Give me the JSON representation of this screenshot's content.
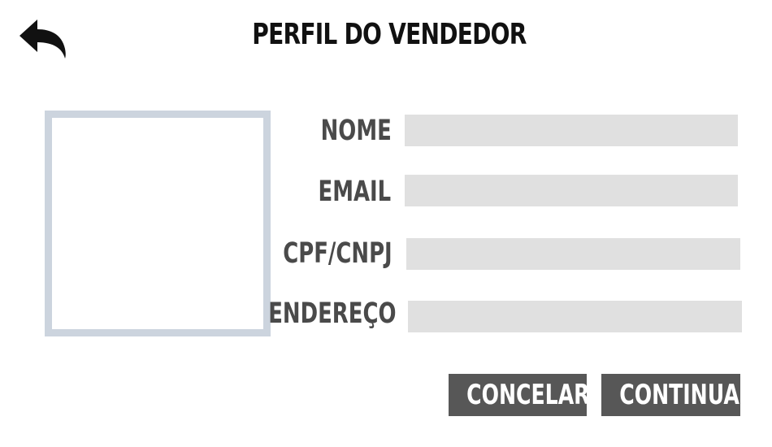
{
  "header": {
    "back_icon": "back-arrow-icon",
    "title": "PERFIL DO VENDEDOR"
  },
  "photo": {
    "border_color": "#ccd4de"
  },
  "form": {
    "fields": [
      {
        "label": "NOME",
        "value": "",
        "placeholder": ""
      },
      {
        "label": "EMAIL",
        "value": "",
        "placeholder": ""
      },
      {
        "label": "CPF/CNPJ",
        "value": "",
        "placeholder": ""
      },
      {
        "label": "ENDEREÇO",
        "value": "",
        "placeholder": ""
      }
    ],
    "input_background": "#e0e0e0"
  },
  "actions": {
    "cancel_label": "CONCELAR",
    "continue_label": "CONTINUAR",
    "button_color": "#575757"
  }
}
